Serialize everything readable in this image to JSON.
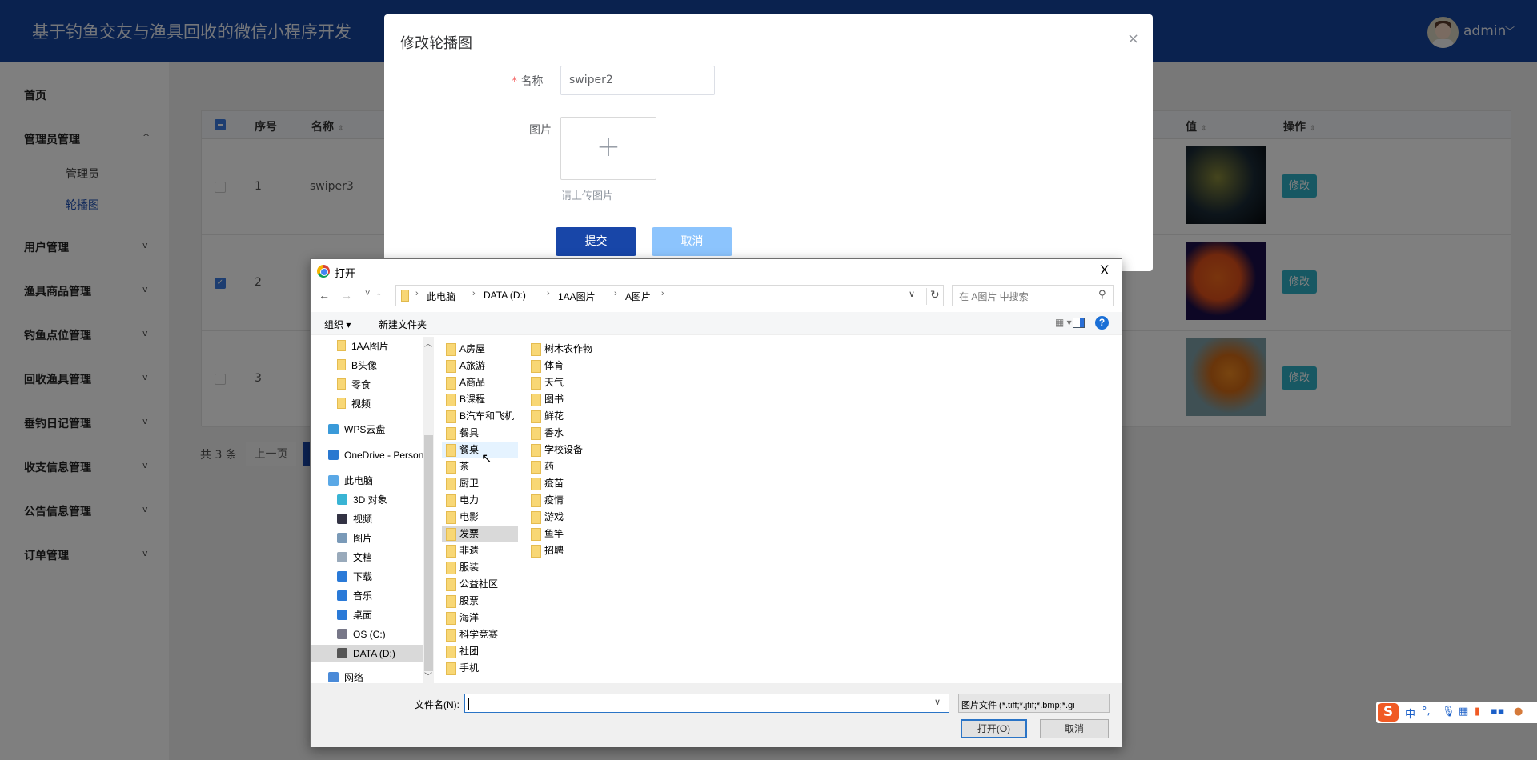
{
  "header": {
    "title": "基于钓鱼交友与渔具回收的微信小程序开发",
    "user": "admin",
    "brand_color": "#14449f"
  },
  "sidebar": {
    "items": [
      {
        "label": "首页",
        "chevron": ""
      },
      {
        "label": "管理员管理",
        "chevron": "^",
        "children": [
          {
            "label": "管理员",
            "active": false
          },
          {
            "label": "轮播图",
            "active": true
          }
        ]
      },
      {
        "label": "用户管理",
        "chevron": "v"
      },
      {
        "label": "渔具商品管理",
        "chevron": "v"
      },
      {
        "label": "钓鱼点位管理",
        "chevron": "v"
      },
      {
        "label": "回收渔具管理",
        "chevron": "v"
      },
      {
        "label": "垂钓日记管理",
        "chevron": "v"
      },
      {
        "label": "收支信息管理",
        "chevron": "v"
      },
      {
        "label": "公告信息管理",
        "chevron": "v"
      },
      {
        "label": "订单管理",
        "chevron": "v"
      }
    ]
  },
  "table": {
    "columns": {
      "index": "序号",
      "name": "名称",
      "value": "值",
      "actions": "操作"
    },
    "sort_icon": "⇕",
    "rows": [
      {
        "index": "1",
        "name": "swiper3",
        "checked": false,
        "image": "fish-dark-yellow",
        "action": "修改"
      },
      {
        "index": "2",
        "name": "swiper2",
        "checked": true,
        "image": "fish-orange-discus",
        "action": "修改"
      },
      {
        "index": "3",
        "name": "",
        "checked": false,
        "image": "fish-goldfish",
        "action": "修改"
      }
    ]
  },
  "pagination": {
    "total": "共 3 条",
    "prev": "上一页"
  },
  "modal": {
    "title": "修改轮播图",
    "close": "×",
    "required_mark": "*",
    "name_label": "名称",
    "name_value": "swiper2",
    "image_label": "图片",
    "upload_plus": "+",
    "upload_tip": "请上传图片",
    "submit": "提交",
    "cancel": "取消"
  },
  "file_dialog": {
    "title": "打开",
    "close": "X",
    "nav": {
      "back": "←",
      "forward": "→",
      "recent": "˅",
      "up": "↑"
    },
    "breadcrumb": [
      "此电脑",
      "DATA (D:)",
      "1AA图片",
      "A图片"
    ],
    "search_placeholder": "在 A图片 中搜索",
    "toolbar": {
      "organize": "组织 ▾",
      "new_folder": "新建文件夹",
      "help": "?"
    },
    "nav_pane": [
      {
        "label": "1AA图片",
        "icon": "folder",
        "indent": 2
      },
      {
        "label": "B头像",
        "icon": "folder",
        "indent": 2
      },
      {
        "label": "零食",
        "icon": "folder",
        "indent": 2
      },
      {
        "label": "视频",
        "icon": "folder",
        "indent": 2
      },
      {
        "label": "WPS云盘",
        "icon": "cloud",
        "indent": 1
      },
      {
        "label": "OneDrive - Personal",
        "icon": "onedrive",
        "indent": 1
      },
      {
        "label": "此电脑",
        "icon": "computer",
        "indent": 1
      },
      {
        "label": "3D 对象",
        "icon": "cube",
        "indent": 2
      },
      {
        "label": "视频",
        "icon": "video",
        "indent": 2
      },
      {
        "label": "图片",
        "icon": "picture",
        "indent": 2
      },
      {
        "label": "文档",
        "icon": "document",
        "indent": 2
      },
      {
        "label": "下载",
        "icon": "download",
        "indent": 2
      },
      {
        "label": "音乐",
        "icon": "music",
        "indent": 2
      },
      {
        "label": "桌面",
        "icon": "desktop",
        "indent": 2
      },
      {
        "label": "OS (C:)",
        "icon": "drive-os",
        "indent": 2
      },
      {
        "label": "DATA (D:)",
        "icon": "drive",
        "indent": 2,
        "selected": true
      },
      {
        "label": "网络",
        "icon": "network",
        "indent": 1
      }
    ],
    "folders_col1": [
      "A房屋",
      "A旅游",
      "A商品",
      "B课程",
      "B汽车和飞机",
      "餐具",
      "餐桌",
      "茶",
      "厨卫",
      "电力",
      "电影",
      "发票",
      "非遗",
      "服装",
      "公益社区",
      "股票",
      "海洋",
      "科学竞赛",
      "社团",
      "手机"
    ],
    "folders_col2": [
      "树木农作物",
      "体育",
      "天气",
      "图书",
      "鲜花",
      "香水",
      "学校设备",
      "药",
      "疫苗",
      "疫情",
      "游戏",
      "鱼竿",
      "招聘"
    ],
    "hovered": "餐桌",
    "selected": "发票",
    "filename_label": "文件名(N):",
    "filename_value": "",
    "filter": "图片文件 (*.tiff;*.jfif;*.bmp;*.gi",
    "open": "打开(O)",
    "cancel": "取消"
  },
  "ime": {
    "logo": "S",
    "mode": "中",
    "punct": "°,",
    "items": [
      "mic",
      "keyboard",
      "skin",
      "apps",
      "avatar"
    ]
  }
}
